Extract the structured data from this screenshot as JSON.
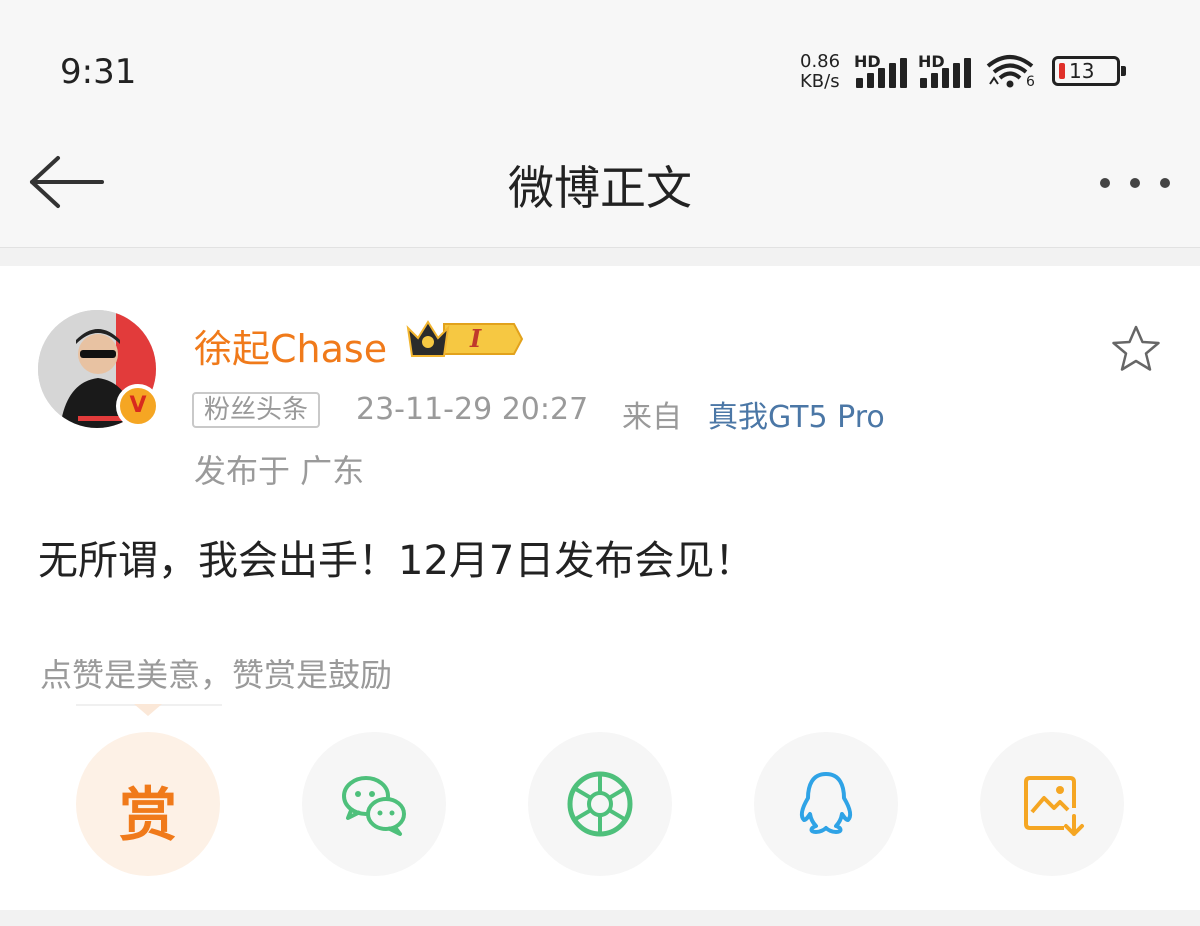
{
  "status_bar": {
    "time": "9:31",
    "net_speed_value": "0.86",
    "net_speed_unit": "KB/s",
    "sim1_label": "HD",
    "sim2_label": "HD",
    "wifi_index": "6",
    "battery_level": "13",
    "battery_color": "#e0302a"
  },
  "nav": {
    "title": "微博正文",
    "back_icon": "back-arrow-icon",
    "more_icon": "more-dots-icon"
  },
  "post": {
    "username": "徐起Chase",
    "verified_badge": "V",
    "vip_badge_icon": "crown-vip-icon",
    "vip_level": "I",
    "tag": "粉丝头条",
    "timestamp": "23-11-29 20:27",
    "from_label": "来自",
    "device": "真我GT5 Pro",
    "location": "发布于 广东",
    "text": "无所谓，我会出手！12月7日发布会见！",
    "favorite_icon": "star-outline-icon"
  },
  "reward": {
    "hint": "点赞是美意，赞赏是鼓励"
  },
  "share": [
    {
      "name": "reward",
      "label": "赏",
      "icon": "reward-icon",
      "color": "#f07a1a"
    },
    {
      "name": "wechat",
      "icon": "wechat-icon",
      "color": "#4ec07b"
    },
    {
      "name": "moments",
      "icon": "wechat-moments-icon",
      "color": "#4ec07b"
    },
    {
      "name": "qq",
      "icon": "qq-icon",
      "color": "#2fa3e6"
    },
    {
      "name": "save-image",
      "icon": "save-image-icon",
      "color": "#f5a623"
    }
  ],
  "colors": {
    "accent_orange": "#f07a1a",
    "link_blue": "#4b77a6",
    "meta_gray": "#9a9a9a"
  }
}
